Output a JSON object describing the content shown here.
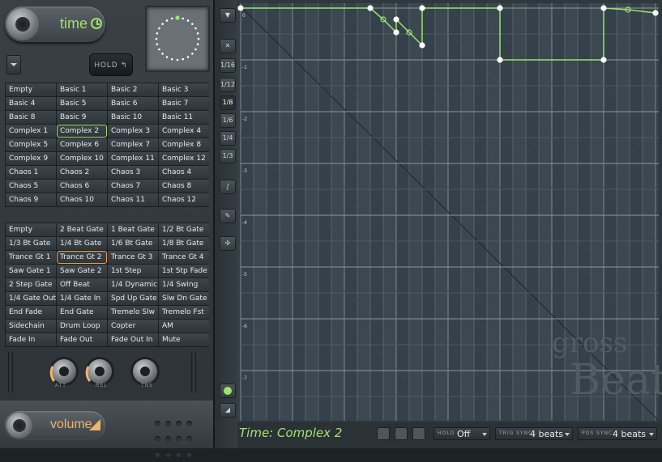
{
  "header": {
    "title": "time"
  },
  "hold": {
    "label": "HOLD"
  },
  "presets_time": [
    [
      "Empty",
      "Basic 1",
      "Basic 2",
      "Basic 3"
    ],
    [
      "Basic 4",
      "Basic 5",
      "Basic 6",
      "Basic 7"
    ],
    [
      "Basic 8",
      "Basic 9",
      "Basic 10",
      "Basic 11"
    ],
    [
      "Complex 1",
      "Complex 2",
      "Complex 3",
      "Complex 4"
    ],
    [
      "Complex 5",
      "Complex 6",
      "Complex 7",
      "Complex 8"
    ],
    [
      "Complex 9",
      "Complex 10",
      "Complex 11",
      "Complex 12"
    ],
    [
      "Chaos 1",
      "Chaos 2",
      "Chaos 3",
      "Chaos 4"
    ],
    [
      "Chaos 5",
      "Chaos 6",
      "Chaos 7",
      "Chaos 8"
    ],
    [
      "Chaos 9",
      "Chaos 10",
      "Chaos 11",
      "Chaos 12"
    ]
  ],
  "selected_time": "Complex 2",
  "presets_volume": [
    [
      "Empty",
      "2 Beat Gate",
      "1 Beat Gate",
      "1/2 Bt Gate"
    ],
    [
      "1/3 Bt Gate",
      "1/4 Bt Gate",
      "1/6 Bt Gate",
      "1/8 Bt Gate"
    ],
    [
      "Trance Gt 1",
      "Trance Gt 2",
      "Trance Gt 3",
      "Trance Gt 4"
    ],
    [
      "Saw Gate 1",
      "Saw Gate 2",
      "1st Step",
      "1st Stp Fade"
    ],
    [
      "2 Step Gate",
      "Off Beat",
      "1/4 Dynamic",
      "1/4 Swing"
    ],
    [
      "1/4 Gate Out",
      "1/4 Gate In",
      "Spd Up Gate",
      "Slw Dn Gate"
    ],
    [
      "End Fade",
      "End Gate",
      "Tremelo Slw",
      "Tremelo Fst"
    ],
    [
      "Sidechain",
      "Drum Loop",
      "Copter",
      "AM"
    ],
    [
      "Fade In",
      "Fade Out",
      "Fade Out In",
      "Mute"
    ]
  ],
  "selected_volume": "Trance Gt 2",
  "knobs": {
    "att": "ATT",
    "rel": "REL",
    "tns": "TNS"
  },
  "volume_header": {
    "title": "volume"
  },
  "toolbar": {
    "buttons": [
      "▼",
      "✕",
      "1/16",
      "1/12",
      "1/8",
      "1/6",
      "1/4",
      "1/3",
      "∫",
      "✎",
      "✣"
    ],
    "active_index": 4
  },
  "editor": {
    "y_labels": [
      "0",
      "-1",
      "-2",
      "-3",
      "-4",
      "-5",
      "-6",
      "-7"
    ],
    "watermark_top": "gross",
    "watermark_bottom": "Beat",
    "accent_color": "#9ee36a"
  },
  "status": {
    "text": "Time: Complex 2",
    "hold_label": "HOLD :",
    "hold_value": "Off",
    "trig_label": "TRIG SYNC :",
    "trig_value": "4 beats",
    "pos_label": "POS SYNC :",
    "pos_value": "4 beats"
  }
}
